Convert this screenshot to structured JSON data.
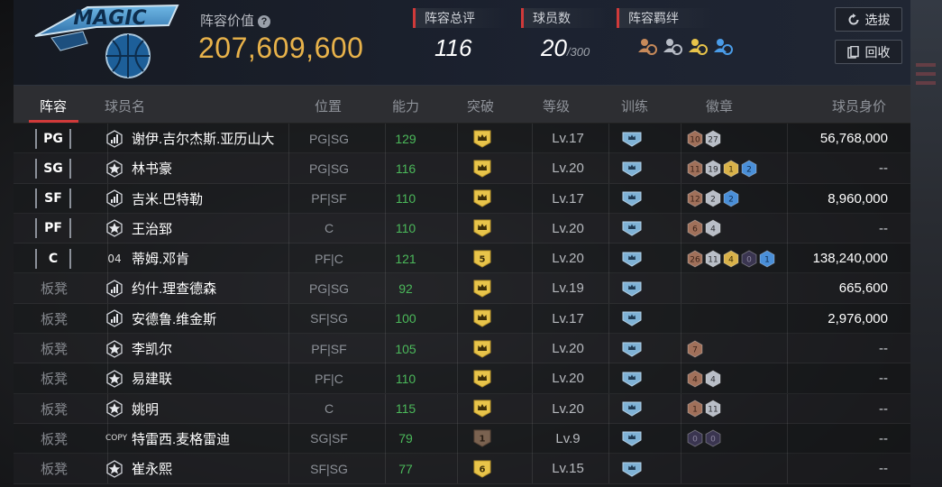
{
  "header": {
    "team_logo_text": "MAGIC",
    "lineup_value_label": "阵容价值",
    "help_glyph": "?",
    "lineup_value": "207,609,600",
    "stats": [
      {
        "label": "阵容总评",
        "value": "116",
        "sub": ""
      },
      {
        "label": "球员数",
        "value": "20",
        "sub": "/300"
      },
      {
        "label": "阵容羁绊",
        "value": "",
        "sub": ""
      }
    ],
    "bond_icons": [
      {
        "name": "bond-icon-bronze",
        "color": "#c88a5a"
      },
      {
        "name": "bond-icon-silver",
        "color": "#b7bcc6"
      },
      {
        "name": "bond-icon-gold",
        "color": "#e8c44a"
      },
      {
        "name": "bond-icon-blue",
        "color": "#4a9ce8"
      }
    ],
    "buttons": [
      {
        "label": "选拔",
        "icon": "refresh-icon"
      },
      {
        "label": "回收",
        "icon": "recycle-icon"
      }
    ]
  },
  "columns": {
    "lineup": "阵容",
    "name": "球员名",
    "position": "位置",
    "ability": "能力",
    "breakthrough": "突破",
    "level": "等级",
    "training": "训练",
    "badges": "徽章",
    "salary": "球员身价"
  },
  "colors": {
    "accent": "#d03a3a",
    "gold": "#e8b24a",
    "ability_green": "#4bb85a",
    "badge_bronze": "#a0705a",
    "badge_silver": "#b9bec7",
    "badge_gold": "#d9b24a",
    "badge_blue": "#4a8fd8",
    "badge_dark": "#3a3550"
  },
  "players": [
    {
      "slot": "PG",
      "is_starter": true,
      "type": "bars",
      "name": "谢伊.吉尔杰斯.亚历山大",
      "position": "PG|SG",
      "ability": "129",
      "break": "crown",
      "break_color": "gold",
      "level": "Lv.17",
      "badges": [
        {
          "t": "bronze",
          "n": "10"
        },
        {
          "t": "silver",
          "n": "27"
        }
      ],
      "salary": "56,768,000"
    },
    {
      "slot": "SG",
      "is_starter": true,
      "type": "star",
      "name": "林书豪",
      "position": "PG|SG",
      "ability": "116",
      "break": "crown",
      "break_color": "gold",
      "level": "Lv.20",
      "badges": [
        {
          "t": "bronze",
          "n": "11"
        },
        {
          "t": "silver",
          "n": "19"
        },
        {
          "t": "gold",
          "n": "1"
        },
        {
          "t": "blue",
          "n": "2"
        }
      ],
      "salary": "--"
    },
    {
      "slot": "SF",
      "is_starter": true,
      "type": "bars",
      "name": "吉米.巴特勒",
      "position": "PF|SF",
      "ability": "110",
      "break": "crown",
      "break_color": "gold",
      "level": "Lv.17",
      "badges": [
        {
          "t": "bronze",
          "n": "12"
        },
        {
          "t": "silver",
          "n": "2"
        },
        {
          "t": "blue",
          "n": "2"
        }
      ],
      "salary": "8,960,000"
    },
    {
      "slot": "PF",
      "is_starter": true,
      "type": "star",
      "name": "王治郅",
      "position": "C",
      "ability": "110",
      "break": "crown",
      "break_color": "gold",
      "level": "Lv.20",
      "badges": [
        {
          "t": "bronze",
          "n": "6"
        },
        {
          "t": "silver",
          "n": "4"
        }
      ],
      "salary": "--"
    },
    {
      "slot": "C",
      "is_starter": true,
      "type": "num",
      "type_text": "04",
      "name": "蒂姆.邓肯",
      "position": "PF|C",
      "ability": "121",
      "break": "5",
      "break_color": "gold",
      "level": "Lv.20",
      "badges": [
        {
          "t": "bronze",
          "n": "26"
        },
        {
          "t": "silver",
          "n": "11"
        },
        {
          "t": "gold",
          "n": "4"
        },
        {
          "t": "dark",
          "n": "0"
        },
        {
          "t": "blue",
          "n": "1"
        }
      ],
      "salary": "138,240,000"
    },
    {
      "slot": "板凳",
      "is_starter": false,
      "type": "bars",
      "name": "约什.理查德森",
      "position": "PG|SG",
      "ability": "92",
      "break": "crown",
      "break_color": "gold",
      "level": "Lv.19",
      "badges": [],
      "salary": "665,600"
    },
    {
      "slot": "板凳",
      "is_starter": false,
      "type": "bars",
      "name": "安德鲁.维金斯",
      "position": "SF|SG",
      "ability": "100",
      "break": "crown",
      "break_color": "gold",
      "level": "Lv.17",
      "badges": [],
      "salary": "2,976,000"
    },
    {
      "slot": "板凳",
      "is_starter": false,
      "type": "star",
      "name": "李凯尔",
      "position": "PF|SF",
      "ability": "105",
      "break": "crown",
      "break_color": "gold",
      "level": "Lv.20",
      "badges": [
        {
          "t": "bronze",
          "n": "7"
        }
      ],
      "salary": "--"
    },
    {
      "slot": "板凳",
      "is_starter": false,
      "type": "star",
      "name": "易建联",
      "position": "PF|C",
      "ability": "110",
      "break": "crown",
      "break_color": "gold",
      "level": "Lv.20",
      "badges": [
        {
          "t": "bronze",
          "n": "4"
        },
        {
          "t": "silver",
          "n": "4"
        }
      ],
      "salary": "--"
    },
    {
      "slot": "板凳",
      "is_starter": false,
      "type": "star",
      "name": "姚明",
      "position": "C",
      "ability": "115",
      "break": "crown",
      "break_color": "gold",
      "level": "Lv.20",
      "badges": [
        {
          "t": "bronze",
          "n": "1"
        },
        {
          "t": "silver",
          "n": "11"
        }
      ],
      "salary": "--"
    },
    {
      "slot": "板凳",
      "is_starter": false,
      "type": "copy",
      "type_text": "COPY",
      "name": "特雷西.麦格雷迪",
      "position": "SG|SF",
      "ability": "79",
      "break": "1",
      "break_color": "brown",
      "level": "Lv.9",
      "badges": [
        {
          "t": "dark",
          "n": "0"
        },
        {
          "t": "dark",
          "n": "0"
        }
      ],
      "salary": "--"
    },
    {
      "slot": "板凳",
      "is_starter": false,
      "type": "star",
      "name": "崔永熙",
      "position": "SF|SG",
      "ability": "77",
      "break": "6",
      "break_color": "gold",
      "level": "Lv.15",
      "badges": [],
      "salary": "--"
    }
  ]
}
